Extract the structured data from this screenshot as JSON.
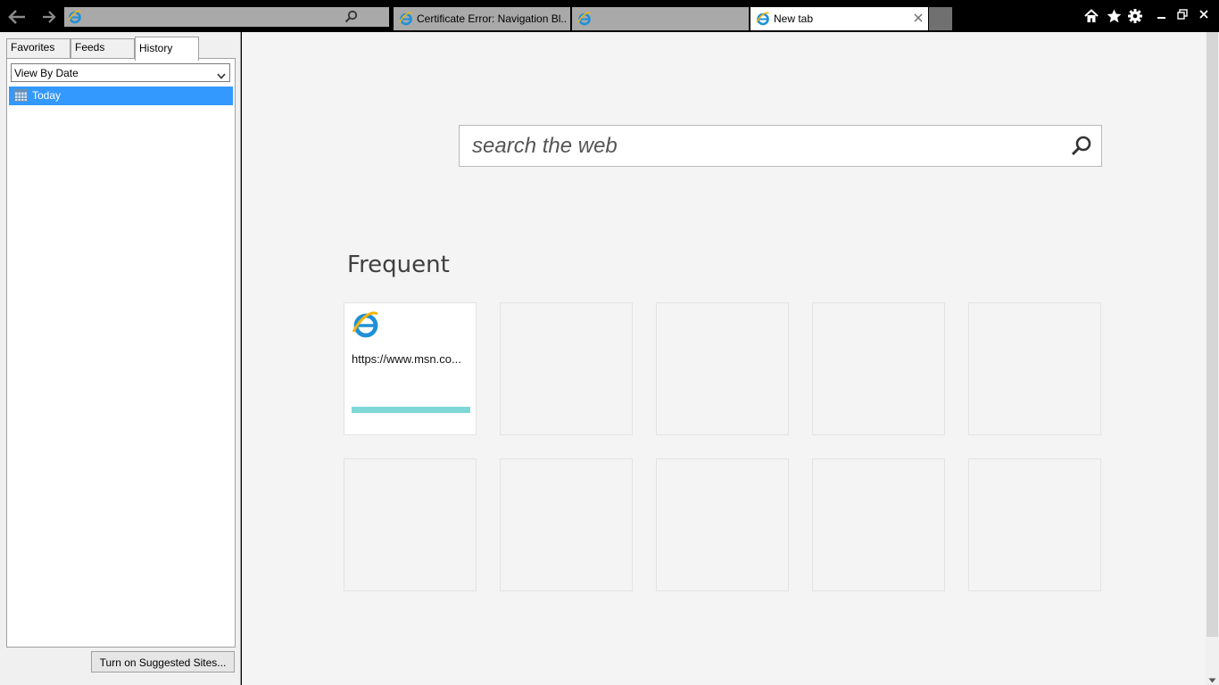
{
  "browser": {
    "address": {
      "value": ""
    },
    "tabs": [
      {
        "label": "Certificate Error: Navigation Bl...",
        "active": false
      },
      {
        "label": "",
        "active": false
      },
      {
        "label": "New tab",
        "active": true
      }
    ]
  },
  "sidepanel": {
    "tabs": [
      "Favorites",
      "Feeds",
      "History"
    ],
    "active_tab": "History",
    "view": "View By Date",
    "items": [
      {
        "label": "Today",
        "selected": true
      }
    ],
    "suggest_button": "Turn on Suggested Sites..."
  },
  "newtab": {
    "search_placeholder": "search the web",
    "section_title": "Frequent",
    "tiles": [
      {
        "url": "https://www.msn.co...",
        "usage": 1.0
      },
      {},
      {},
      {},
      {},
      {},
      {},
      {},
      {},
      {}
    ]
  },
  "colors": {
    "selection": "#3399ff",
    "ie_blue": "#1e90d8",
    "ie_gold": "#f5b50a",
    "tile_bar": "#7fd8d8"
  }
}
